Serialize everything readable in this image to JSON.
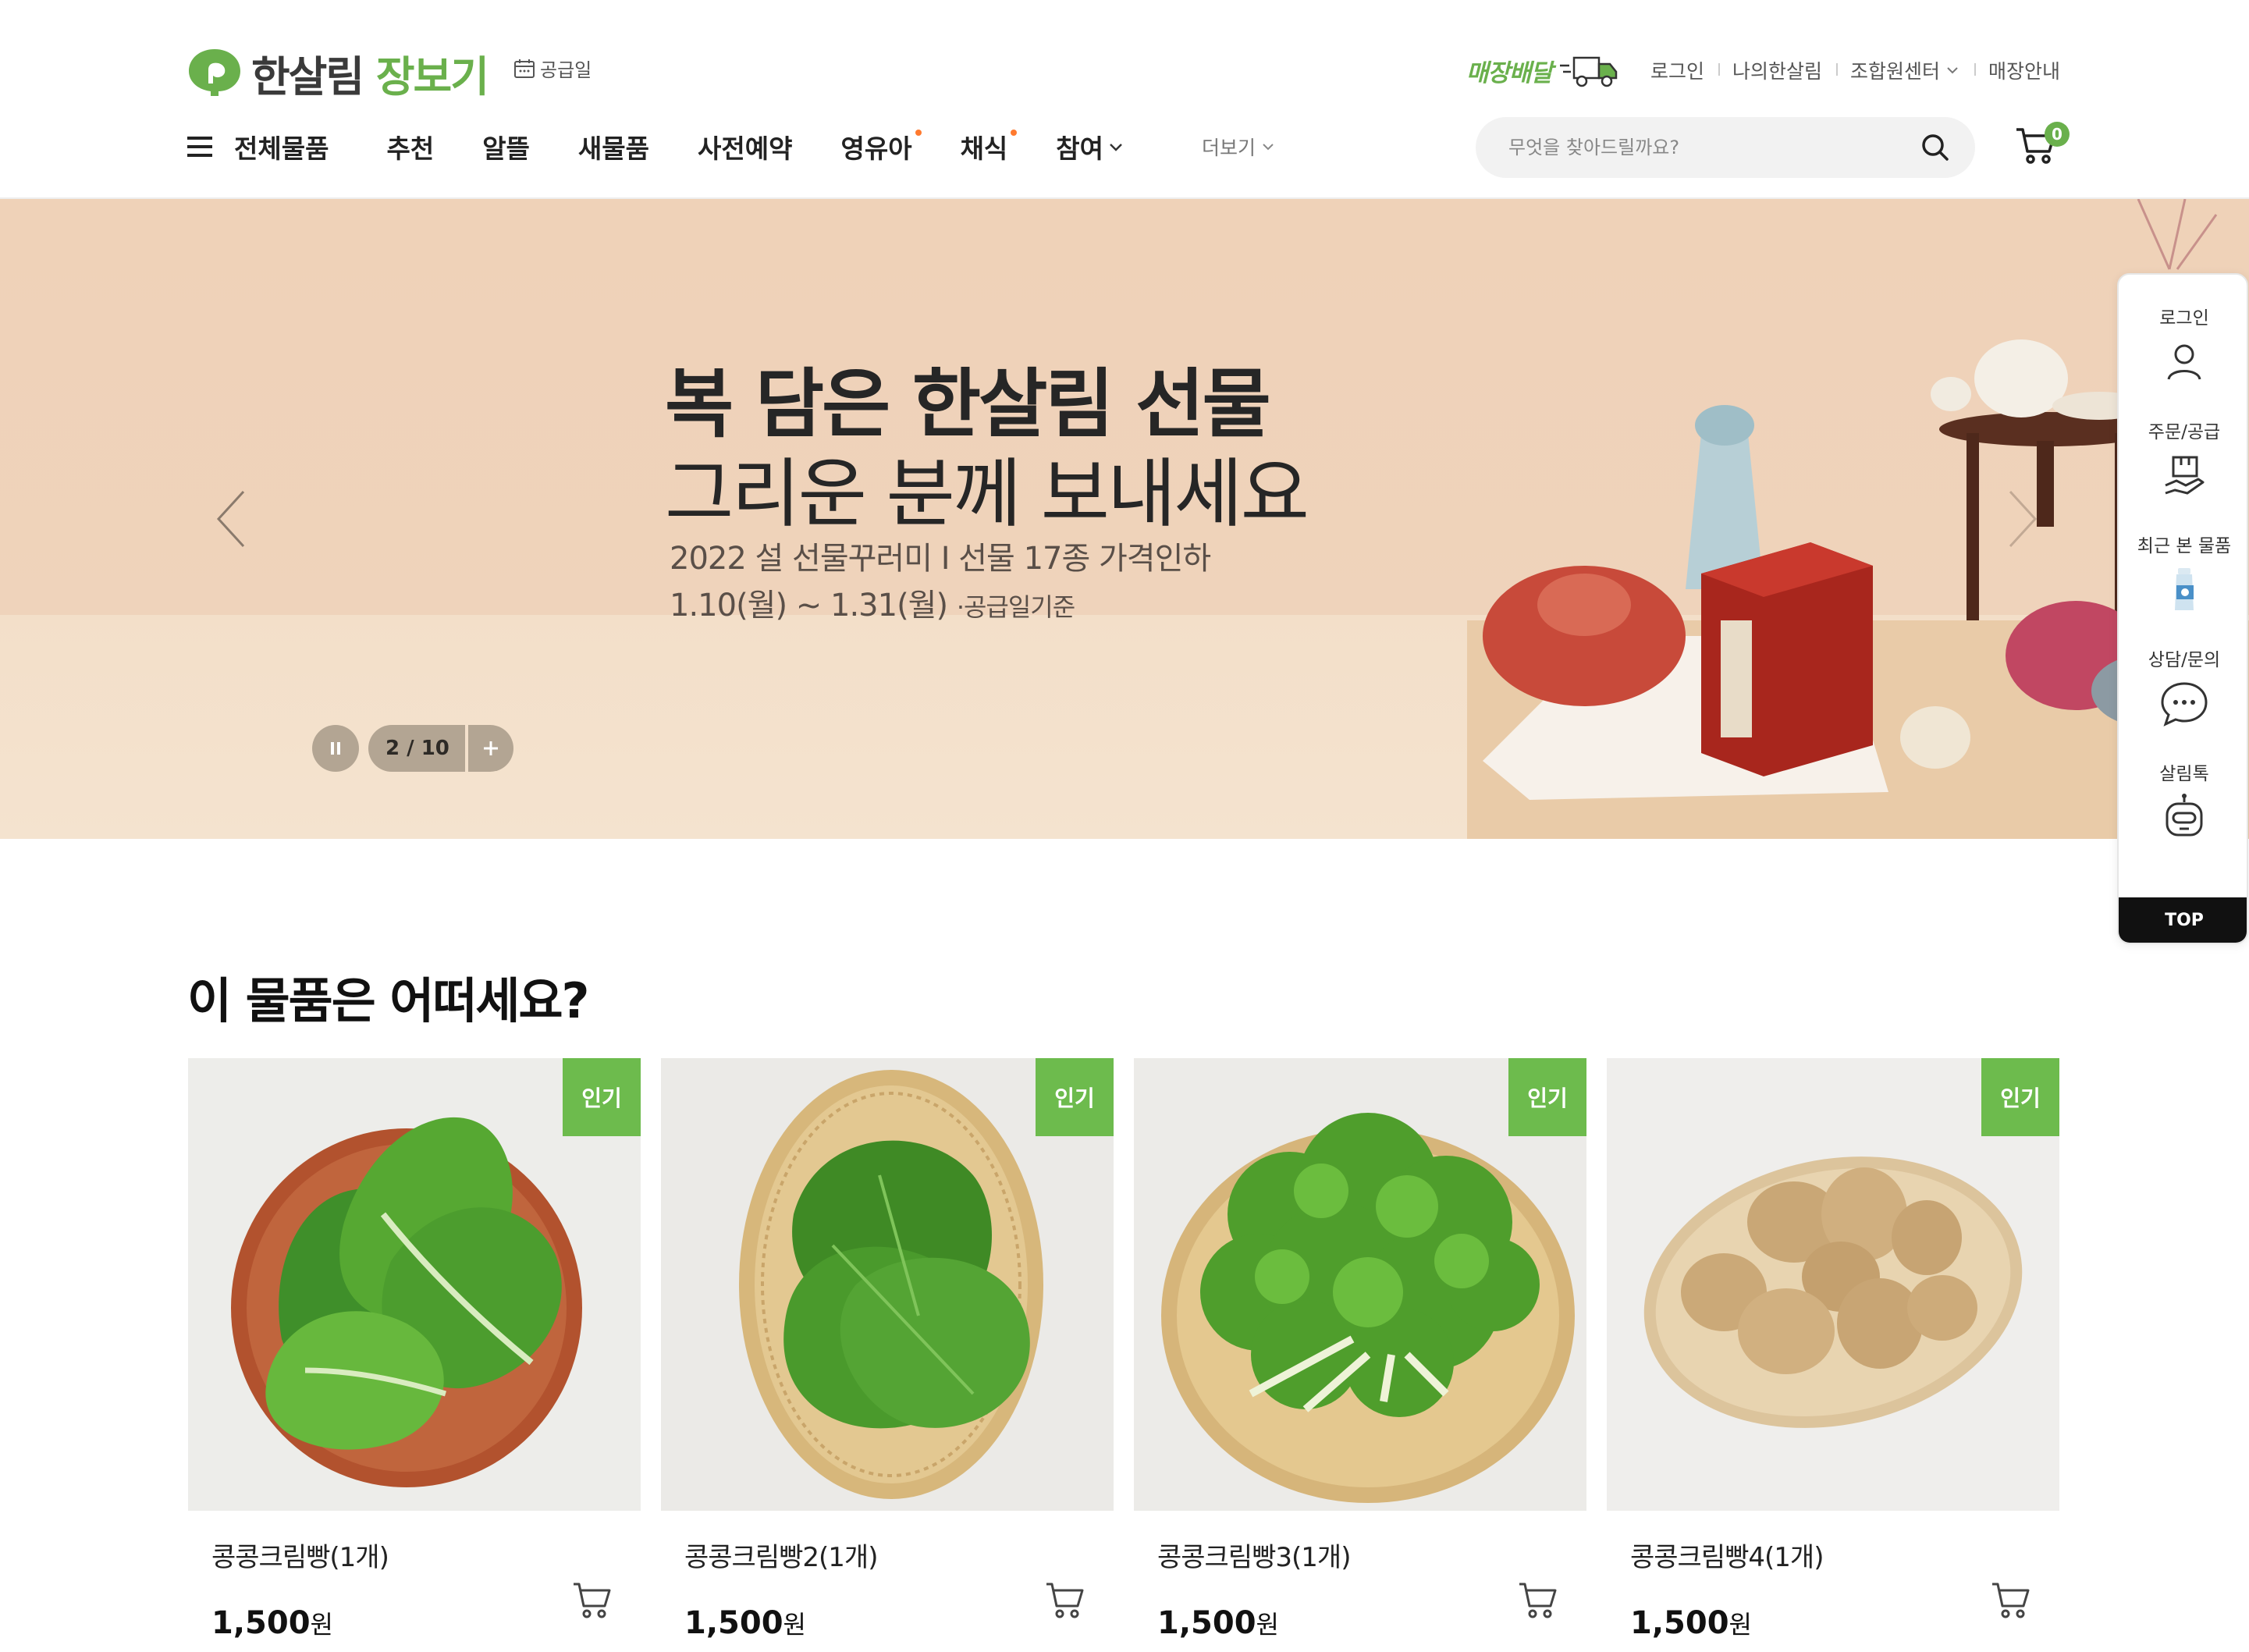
{
  "brand": {
    "name_part1": "한살림",
    "name_part2": "장보기",
    "logo_color": "#6ab04c"
  },
  "header": {
    "supply_date_label": "공급일",
    "delivery_label": "매장배달",
    "util_links": [
      "로그인",
      "나의한살림",
      "조합원센터",
      "매장안내"
    ],
    "nav_all": "전체물품",
    "nav_items": [
      "추천",
      "알뜰",
      "새물품",
      "사전예약",
      "영유아",
      "채식",
      "참여"
    ],
    "nav_more": "더보기",
    "search_placeholder": "무엇을 찾아드릴까요?",
    "cart_count": "0"
  },
  "banner": {
    "title_line1": "복 담은 한살림 선물",
    "title_line2": "그리운 분께 보내세요",
    "subtitle_line1": "2022 설 선물꾸러미 I 선물 17종 가격인하",
    "subtitle_line2": "1.10(월) ~ 1.31(월)",
    "subtitle_note": "·공급일기준",
    "counter": "2 / 10",
    "background_color": "#efd2b8"
  },
  "quick_menu": {
    "items": [
      "로그인",
      "주문/공급",
      "최근 본 물품",
      "상담/문의",
      "살림톡"
    ],
    "top_label": "TOP"
  },
  "section": {
    "title": "이 물품은 어떠세요?",
    "badge_label": "인기",
    "price_unit": "원",
    "products": [
      {
        "name": "콩콩크림빵(1개)",
        "price": "1,500",
        "image": "romaine-lettuce"
      },
      {
        "name": "콩콩크림빵2(1개)",
        "price": "1,500",
        "image": "perilla-leaves"
      },
      {
        "name": "콩콩크림빵3(1개)",
        "price": "1,500",
        "image": "frisee-lettuce"
      },
      {
        "name": "콩콩크림빵4(1개)",
        "price": "1,500",
        "image": "potatoes"
      }
    ]
  }
}
